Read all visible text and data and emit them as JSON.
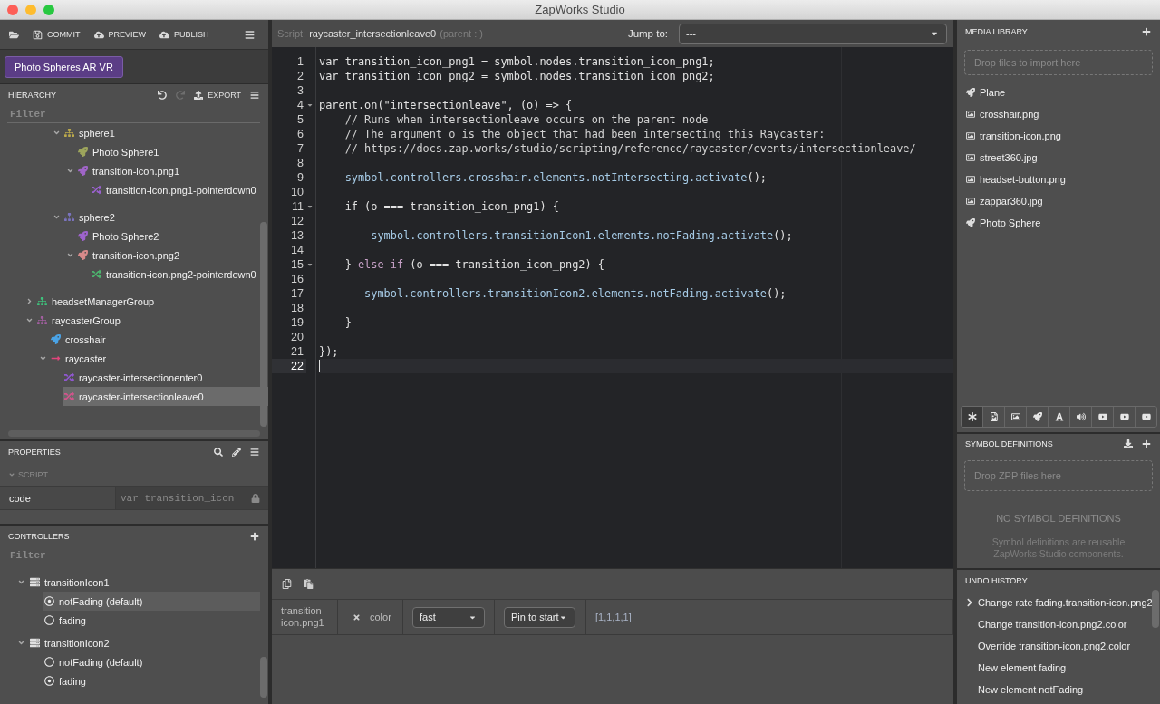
{
  "window": {
    "title": "ZapWorks Studio"
  },
  "toolbar": [
    {
      "kind": "open"
    },
    {
      "kind": "commit",
      "label": "COMMIT"
    },
    {
      "kind": "preview",
      "label": "PREVIEW"
    },
    {
      "kind": "publish",
      "label": "PUBLISH"
    },
    {
      "kind": "menu"
    }
  ],
  "project": {
    "name": "Photo Spheres AR VR"
  },
  "hierarchy": {
    "title": "HIERARCHY",
    "actions": [
      {
        "kind": "undo",
        "disabled": false
      },
      {
        "kind": "redo",
        "disabled": true
      },
      {
        "kind": "export",
        "label": "EXPORT",
        "disabled": false
      },
      {
        "kind": "menu",
        "disabled": false
      }
    ],
    "filter": {
      "placeholder": "Filter"
    },
    "tree": [
      {
        "children": [
          {
            "children": [
              {
                "children": [
                  {
                    "label": "sphere1",
                    "kind": "group",
                    "color": "#bcaa4c",
                    "expanded": true,
                    "selected": false,
                    "children": [
                      {
                        "label": "Photo Sphere1",
                        "kind": "plane",
                        "color": "#9da55c",
                        "selected": false
                      },
                      {
                        "label": "transition-icon.png1",
                        "kind": "plane",
                        "color": "#a065c8",
                        "expanded": true,
                        "selected": false,
                        "children": [
                          {
                            "label": "transition-icon.png1-pointerdown0",
                            "kind": "script",
                            "color": "#9b62d0",
                            "selected": false
                          }
                        ]
                      }
                    ]
                  },
                  {
                    "label": "sphere2",
                    "kind": "group",
                    "color": "#7b74c0",
                    "expanded": true,
                    "selected": false,
                    "children": [
                      {
                        "label": "Photo Sphere2",
                        "kind": "plane",
                        "color": "#9e63cc",
                        "selected": false
                      },
                      {
                        "label": "transition-icon.png2",
                        "kind": "plane",
                        "color": "#d98a8a",
                        "expanded": true,
                        "selected": false,
                        "children": [
                          {
                            "label": "transition-icon.png2-pointerdown0",
                            "kind": "script",
                            "color": "#4db46e",
                            "selected": false
                          }
                        ]
                      }
                    ]
                  }
                ]
              }
            ]
          },
          {
            "label": "headsetManagerGroup",
            "kind": "group",
            "color": "#3ec27c",
            "expanded": false,
            "selected": false
          },
          {
            "label": "raycasterGroup",
            "kind": "group",
            "color": "#a25fa0",
            "expanded": true,
            "selected": false,
            "children": [
              {
                "label": "crosshair",
                "kind": "plane",
                "color": "#4aa3e6",
                "selected": false
              },
              {
                "label": "raycaster",
                "kind": "raycaster",
                "color": "#e2457c",
                "expanded": true,
                "selected": false,
                "children": [
                  {
                    "label": "raycaster-intersectionenter0",
                    "kind": "script",
                    "color": "#9058d0",
                    "selected": false
                  },
                  {
                    "label": "raycaster-intersectionleave0",
                    "kind": "script",
                    "color": "#d2548c",
                    "selected": true
                  }
                ]
              }
            ]
          }
        ]
      }
    ]
  },
  "properties": {
    "title": "PROPERTIES",
    "actions": [
      {
        "kind": "search"
      },
      {
        "kind": "edit"
      },
      {
        "kind": "menu"
      }
    ],
    "section": {
      "title": "SCRIPT",
      "expanded": true
    },
    "rows": [
      {
        "label": "code",
        "value": "var transition_icon",
        "locked": true
      }
    ]
  },
  "controllers": {
    "title": "CONTROLLERS",
    "actions": [
      {
        "kind": "add"
      }
    ],
    "filter": {
      "placeholder": "Filter"
    },
    "items": [
      {
        "label": "transitionIcon1",
        "expanded": true,
        "states": [
          {
            "label": "notFading (default)",
            "checked": true,
            "selected": true
          },
          {
            "label": "fading",
            "checked": false,
            "selected": false
          }
        ]
      },
      {
        "label": "transitionIcon2",
        "expanded": true,
        "states": [
          {
            "label": "notFading (default)",
            "checked": false,
            "selected": false
          },
          {
            "label": "fading",
            "checked": true,
            "selected": false
          }
        ]
      }
    ]
  },
  "script_bar": {
    "label": "Script:",
    "name": "raycaster_intersectionleave0",
    "parent": "(parent : )",
    "jump_label": "Jump to:",
    "jump_value": "---"
  },
  "editor": {
    "lines": [
      {
        "number": "1",
        "tokens": [
          {
            "text": "var transition_icon_png1 = symbol.nodes.transition_icon_png1;",
            "kind": "plain"
          }
        ],
        "foldable": false,
        "active": false
      },
      {
        "number": "2",
        "tokens": [
          {
            "text": "var transition_icon_png2 = symbol.nodes.transition_icon_png2;",
            "kind": "plain"
          }
        ],
        "foldable": false,
        "active": false
      },
      {
        "number": "3",
        "foldable": false,
        "active": false
      },
      {
        "number": "4",
        "tokens": [
          {
            "text": "parent.on(\"intersectionleave\", (o) => {",
            "kind": "plain"
          }
        ],
        "foldable": true,
        "active": false
      },
      {
        "number": "5",
        "tokens": [
          {
            "text": "    // Runs when intersectionleave occurs on the parent node",
            "kind": "comment"
          }
        ],
        "foldable": false,
        "active": false
      },
      {
        "number": "6",
        "tokens": [
          {
            "text": "    // The argument o is the object that had been intersecting this Raycaster:",
            "kind": "comment"
          }
        ],
        "foldable": false,
        "active": false
      },
      {
        "number": "7",
        "tokens": [
          {
            "text": "    // https://docs.zap.works/studio/scripting/reference/raycaster/events/intersectionleave/",
            "kind": "comment"
          }
        ],
        "foldable": false,
        "active": false
      },
      {
        "number": "8",
        "foldable": false,
        "active": false
      },
      {
        "number": "9",
        "tokens": [
          {
            "text": "    symbol.controllers.crosshair.elements.notIntersecting.activate",
            "kind": "call"
          },
          {
            "text": "();",
            "kind": "plain"
          }
        ],
        "foldable": false,
        "active": false
      },
      {
        "number": "10",
        "foldable": false,
        "active": false
      },
      {
        "number": "11",
        "tokens": [
          {
            "text": "    if (o === transition_icon_png1) {",
            "kind": "plain"
          }
        ],
        "foldable": true,
        "active": false
      },
      {
        "number": "12",
        "foldable": false,
        "active": false
      },
      {
        "number": "13",
        "tokens": [
          {
            "text": "        symbol.controllers.transitionIcon1.elements.notFading.activate",
            "kind": "call"
          },
          {
            "text": "();",
            "kind": "plain"
          }
        ],
        "foldable": false,
        "active": false
      },
      {
        "number": "14",
        "foldable": false,
        "active": false
      },
      {
        "number": "15",
        "tokens": [
          {
            "text": "    } ",
            "kind": "plain"
          },
          {
            "text": "else if",
            "kind": "keyword"
          },
          {
            "text": " (o === transition_icon_png2) {",
            "kind": "plain"
          }
        ],
        "foldable": true,
        "active": false
      },
      {
        "number": "16",
        "foldable": false,
        "active": false
      },
      {
        "number": "17",
        "tokens": [
          {
            "text": "       symbol.controllers.transitionIcon2.elements.notFading.activate",
            "kind": "call"
          },
          {
            "text": "();",
            "kind": "plain"
          }
        ],
        "foldable": false,
        "active": false
      },
      {
        "number": "18",
        "foldable": false,
        "active": false
      },
      {
        "number": "19",
        "tokens": [
          {
            "text": "    }",
            "kind": "plain"
          }
        ],
        "foldable": false,
        "active": false
      },
      {
        "number": "20",
        "foldable": false,
        "active": false
      },
      {
        "number": "21",
        "tokens": [
          {
            "text": "});",
            "kind": "plain"
          }
        ],
        "foldable": false,
        "active": false
      },
      {
        "number": "22",
        "foldable": false,
        "active": true
      }
    ]
  },
  "timeline": {
    "tools": [
      {
        "kind": "copy"
      },
      {
        "kind": "paste"
      }
    ],
    "rows": [
      {
        "target": "transition-icon.png1",
        "property": "color",
        "easing": "fast",
        "pin": "Pin to start",
        "value": "[1,1,1,1]"
      }
    ]
  },
  "media_library": {
    "title": "MEDIA LIBRARY",
    "actions": [
      {
        "kind": "add"
      }
    ],
    "dropzone": "Drop files to import here",
    "items": [
      {
        "label": "Plane",
        "kind": "object"
      },
      {
        "label": "crosshair.png",
        "kind": "image"
      },
      {
        "label": "transition-icon.png",
        "kind": "image"
      },
      {
        "label": "street360.jpg",
        "kind": "image"
      },
      {
        "label": "headset-button.png",
        "kind": "image"
      },
      {
        "label": "zappar360.jpg",
        "kind": "image"
      },
      {
        "label": "Photo Sphere",
        "kind": "object"
      }
    ],
    "filters": [
      {
        "kind": "all",
        "selected": true
      },
      {
        "kind": "file",
        "selected": false
      },
      {
        "kind": "image",
        "selected": false
      },
      {
        "kind": "object",
        "selected": false
      },
      {
        "kind": "text",
        "selected": false
      },
      {
        "kind": "audio",
        "selected": false
      },
      {
        "kind": "video",
        "selected": false
      },
      {
        "kind": "video",
        "selected": false
      },
      {
        "kind": "video",
        "selected": false
      }
    ]
  },
  "symbol_definitions": {
    "title": "SYMBOL DEFINITIONS",
    "actions": [
      {
        "kind": "download"
      },
      {
        "kind": "add"
      }
    ],
    "dropzone": "Drop ZPP files here",
    "empty_title": "NO SYMBOL DEFINITIONS",
    "empty_text": "Symbol definitions are reusable ZapWorks Studio components."
  },
  "undo_history": {
    "title": "UNDO HISTORY",
    "items": [
      {
        "label": "Change rate fading.transition-icon.png2",
        "current": true
      },
      {
        "label": "Change transition-icon.png2.color",
        "current": false
      },
      {
        "label": "Override transition-icon.png2.color",
        "current": false
      },
      {
        "label": "New element fading",
        "current": false
      },
      {
        "label": "New element notFading",
        "current": false
      }
    ]
  }
}
